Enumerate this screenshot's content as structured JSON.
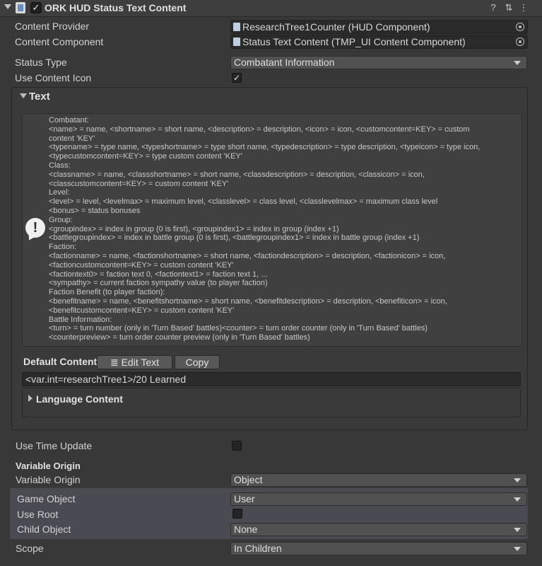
{
  "header": {
    "title": "ORK HUD Status Text Content",
    "enabled": "✓",
    "icons": [
      "help-icon",
      "settings-sliders-icon",
      "more-menu-icon"
    ],
    "help_glyph": "?",
    "sliders_glyph": "⇅",
    "menu_glyph": "⋮"
  },
  "fields": {
    "content_provider_label": "Content Provider",
    "content_provider_value": "ResearchTree1Counter (HUD Component)",
    "content_component_label": "Content Component",
    "content_component_value": "Status Text Content (TMP_UI Content Component)",
    "status_type_label": "Status Type",
    "status_type_value": "Combatant Information",
    "use_content_icon_label": "Use Content Icon",
    "use_content_icon_check": "✓"
  },
  "text_section": {
    "title": "Text",
    "help_glyph": "!",
    "help_lines": [
      "Combatant:",
      "<name> = name, <shortname> = short name, <description> = description, <icon> = icon, <customcontent=KEY> = custom",
      "content 'KEY'",
      "<typename> = type name, <typeshortname> = type short name, <typedescription> = type description, <typeicon> = type icon,",
      "<typecustomcontent=KEY> = type custom content 'KEY'",
      "Class:",
      "<classname> = name, <classshortname> = short name, <classdescription> = description, <classicon> = icon,",
      "<classcustomcontent=KEY> = custom content 'KEY'",
      "Level:",
      "<level> = level, <levelmax> = maximum level, <classlevel> = class level, <classlevelmax> = maximum class level",
      "<bonus> = status bonuses",
      "Group:",
      "<groupindex> = index in group (0 is first), <groupindex1> = index in group (index +1)",
      "<battlegroupindex> = index in battle group (0 is first), <battlegroupindex1> = index in battle group (index +1)",
      "Faction:",
      "<factionname> = name, <factionshortname> = short name, <factiondescription> = description, <factionicon> = icon,",
      "<factioncustomcontent=KEY> = custom content 'KEY'",
      "<factiontext0> = faction text 0, <factiontext1> = faction text 1, ...",
      "<sympathy> = current faction sympathy value (to player faction)",
      "Faction Benefit (to player faction):",
      "<benefitname> = name, <benefitshortname> = short name, <benefitdescription> = description, <benefiticon> = icon,",
      "<benefitcustomcontent=KEY> = custom content 'KEY'",
      "Battle Information:",
      "<turn> = turn number (only in 'Turn Based' battles)<counter> = turn order counter (only in 'Turn Based' battles)",
      "<counterpreview> = turn order counter preview (only in 'Turn Based' battles)"
    ],
    "default_content_label": "Default Content",
    "edit_text_button": "Edit Text",
    "edit_text_glyph": "≣",
    "copy_button": "Copy",
    "default_content_value": "<var.int=researchTree1>/20 Learned",
    "language_content_label": "Language Content"
  },
  "lower": {
    "use_time_update_label": "Use Time Update",
    "variable_origin_header": "Variable Origin",
    "variable_origin_label": "Variable Origin",
    "variable_origin_value": "Object",
    "game_object_label": "Game Object",
    "game_object_value": "User",
    "use_root_label": "Use Root",
    "child_object_label": "Child Object",
    "child_object_value": "None",
    "scope_label": "Scope",
    "scope_value": "In Children"
  },
  "colors": {
    "background": "#383838",
    "highlight": "#4a4a52",
    "field": "#2a2a2a",
    "dropdown": "#515151"
  }
}
